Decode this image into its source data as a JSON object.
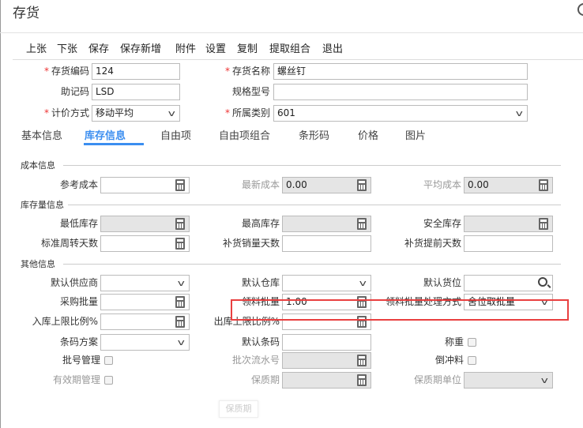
{
  "header": {
    "title": "存货"
  },
  "toolbar": {
    "items": [
      "上张",
      "下张",
      "保存",
      "保存新增",
      "附件",
      "设置",
      "复制",
      "提取组合",
      "退出"
    ]
  },
  "basic_fields": [
    {
      "label": "存货编码",
      "value": "124",
      "required": true,
      "type": "text"
    },
    {
      "label": "存货名称",
      "value": "螺丝钉",
      "required": true,
      "type": "text"
    },
    {
      "label": "助记码",
      "value": "LSD",
      "required": false,
      "type": "text"
    },
    {
      "label": "规格型号",
      "value": "",
      "required": false,
      "type": "text"
    },
    {
      "label": "计价方式",
      "value": "移动平均",
      "required": true,
      "type": "select"
    },
    {
      "label": "所属类别",
      "value": "601",
      "required": true,
      "type": "select"
    }
  ],
  "tabs": {
    "items": [
      "基本信息",
      "库存信息",
      "自由项",
      "自由项组合",
      "条形码",
      "价格",
      "图片"
    ],
    "active": 1
  },
  "sections": [
    {
      "title": "成本信息",
      "fields": [
        {
          "label": "参考成本",
          "value": "",
          "type": "calc"
        },
        {
          "label": "最新成本",
          "value": "0.00",
          "type": "calc",
          "disabled": true,
          "muted": true
        },
        {
          "label": "平均成本",
          "value": "0.00",
          "type": "calc",
          "disabled": true,
          "muted": true
        }
      ]
    },
    {
      "title": "库存量信息",
      "fields": [
        {
          "label": "最低库存",
          "value": "",
          "type": "calc",
          "disabled": true
        },
        {
          "label": "最高库存",
          "value": "",
          "type": "calc",
          "disabled": true
        },
        {
          "label": "安全库存",
          "value": "",
          "type": "calc",
          "disabled": true
        },
        {
          "label": "标准周转天数",
          "value": "",
          "type": "calc"
        },
        {
          "label": "补货销量天数",
          "value": "",
          "type": "text"
        },
        {
          "label": "补货提前天数",
          "value": "",
          "type": "text"
        }
      ]
    },
    {
      "title": "其他信息",
      "fields": [
        {
          "label": "默认供应商",
          "value": "",
          "type": "select"
        },
        {
          "label": "默认仓库",
          "value": "",
          "type": "select"
        },
        {
          "label": "默认货位",
          "value": "",
          "type": "search"
        },
        {
          "label": "采购批量",
          "value": "",
          "type": "calc"
        },
        {
          "label": "领料批量",
          "value": "1.00",
          "type": "calc"
        },
        {
          "label": "领料批量处理方式",
          "value": "舍位取批量",
          "type": "select"
        },
        {
          "label": "入库上限比例%",
          "value": "",
          "type": "calc"
        },
        {
          "label": "出库上限比例%",
          "value": "",
          "type": "calc"
        },
        null,
        {
          "label": "条码方案",
          "value": "",
          "type": "select"
        },
        {
          "label": "默认条码",
          "value": "",
          "type": "text"
        },
        {
          "label": "称重",
          "type": "checkbox",
          "checked": false
        },
        {
          "label": "批号管理",
          "type": "checkbox",
          "checked": false
        },
        {
          "label": "批次流水号",
          "value": "",
          "type": "calc",
          "disabled": true,
          "muted": true
        },
        {
          "label": "倒冲料",
          "type": "checkbox",
          "checked": false
        },
        {
          "label": "有效期管理",
          "type": "checkbox",
          "checked": false,
          "muted": true
        },
        {
          "label": "保质期",
          "value": "",
          "type": "calc",
          "disabled": true,
          "muted": true
        },
        {
          "label": "保质期单位",
          "value": "",
          "type": "select",
          "disabled": true,
          "muted": true
        }
      ]
    }
  ],
  "floating_button": "保质期"
}
